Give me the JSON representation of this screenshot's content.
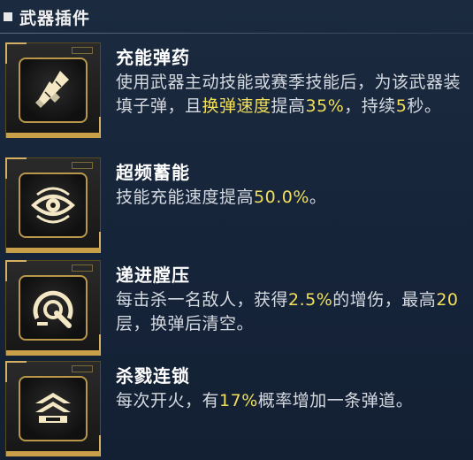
{
  "header": {
    "title": "武器插件"
  },
  "perks": [
    {
      "name": "充能弹药",
      "icon": "bullets-icon",
      "desc": [
        {
          "t": "使用武器主动技能或赛季技能后，为该武器装填子弹，且",
          "h": false
        },
        {
          "t": "换弹速度",
          "h": true
        },
        {
          "t": "提高",
          "h": false
        },
        {
          "t": "35%",
          "h": true
        },
        {
          "t": "，持续",
          "h": false
        },
        {
          "t": "5",
          "h": true
        },
        {
          "t": "秒。",
          "h": false
        }
      ]
    },
    {
      "name": "超频蓄能",
      "icon": "eye-charge-icon",
      "desc": [
        {
          "t": "技能充能速度提高",
          "h": false
        },
        {
          "t": "50.0%",
          "h": true
        },
        {
          "t": "。",
          "h": false
        }
      ]
    },
    {
      "name": "递进膛压",
      "icon": "pressure-gauge-icon",
      "desc": [
        {
          "t": "每击杀一名敌人，获得",
          "h": false
        },
        {
          "t": "2.5%",
          "h": true
        },
        {
          "t": "的增伤，最高",
          "h": false
        },
        {
          "t": "20",
          "h": true
        },
        {
          "t": "层，换弹后清空。",
          "h": false
        }
      ]
    },
    {
      "name": "杀戮连锁",
      "icon": "stacked-chevrons-icon",
      "desc": [
        {
          "t": "每次开火，有",
          "h": false
        },
        {
          "t": "17%",
          "h": true
        },
        {
          "t": "概率增加一条弹道。",
          "h": false
        }
      ]
    }
  ],
  "colors": {
    "highlight": "#f2df5a",
    "gold": "#c8a04a",
    "background": "#1b2a3f"
  }
}
